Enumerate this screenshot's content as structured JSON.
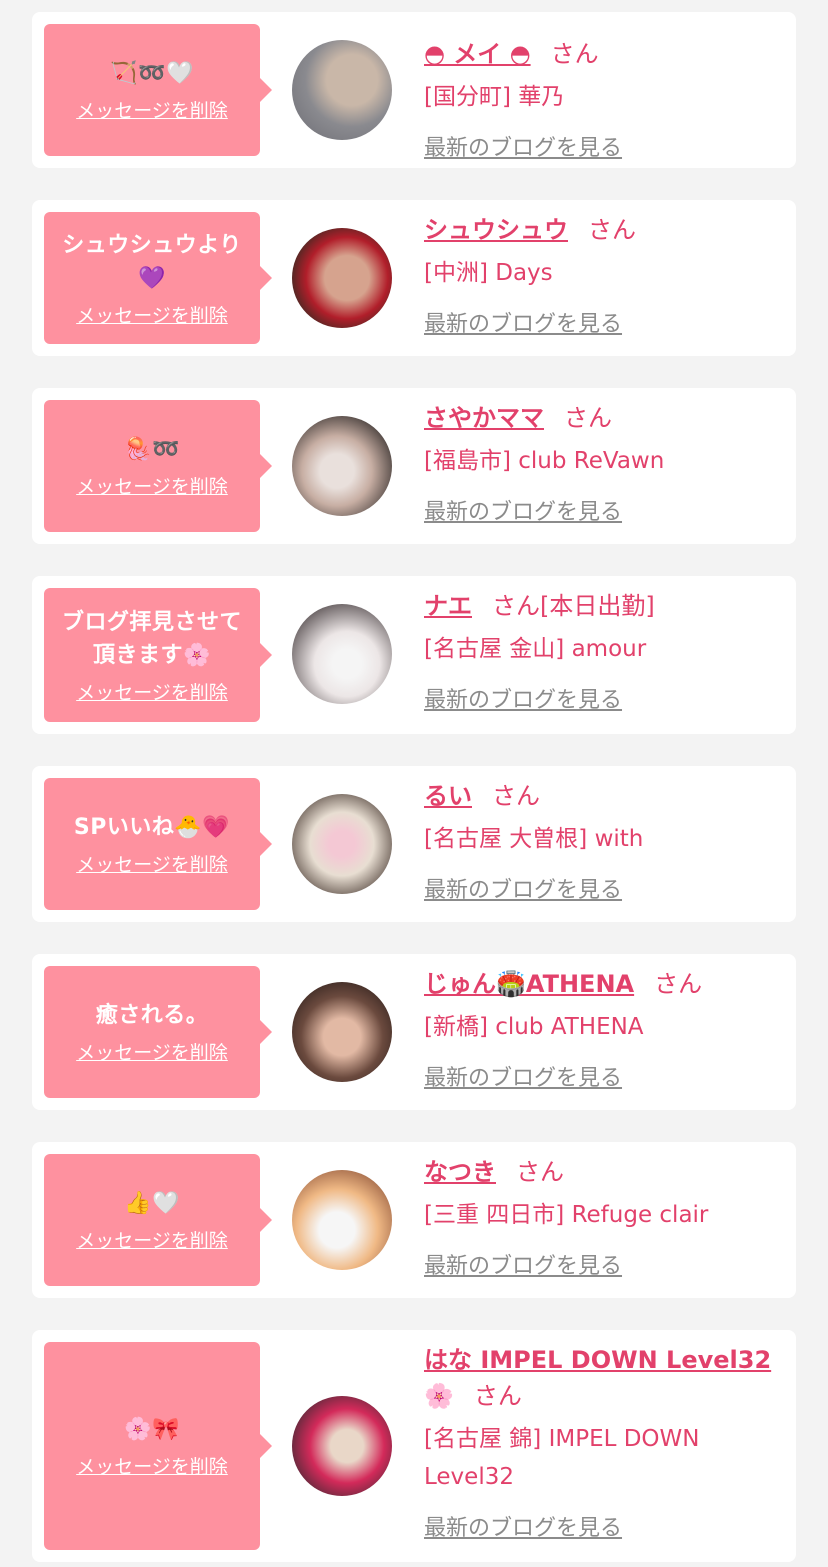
{
  "cards": [
    {
      "message": "🏹➿🤍",
      "delete_label": "メッセージを削除",
      "name": "◓ メイ ◓",
      "honorific": "さん",
      "status": "",
      "shop": "[国分町] 華乃",
      "blog_label": "最新のブログを見る",
      "avatar_colors": [
        "#6b6b72",
        "#c9b7a8",
        "#8a8a8f"
      ]
    },
    {
      "message": "シュウシュウより💜",
      "delete_label": "メッセージを削除",
      "name": "シュウシュウ",
      "honorific": "さん",
      "status": "",
      "shop": "[中洲] Days",
      "blog_label": "最新のブログを見る",
      "avatar_colors": [
        "#3a2a22",
        "#d6a38e",
        "#b11e2a"
      ]
    },
    {
      "message": "🪼➿",
      "delete_label": "メッセージを削除",
      "name": "さやかママ",
      "honorific": "さん",
      "status": "",
      "shop": "[福島市] club ReVawn",
      "blog_label": "最新のブログを見る",
      "avatar_colors": [
        "#2b2625",
        "#c7aea3",
        "#e9e0dc"
      ]
    },
    {
      "message": "ブログ拝見させて頂きます🌸",
      "delete_label": "メッセージを削除",
      "name": "ナエ",
      "honorific": "さん",
      "status": "[本日出勤]",
      "shop": "[名古屋 金山] amour",
      "blog_label": "最新のブログを見る",
      "avatar_colors": [
        "#ece6e6",
        "#3a3133",
        "#f5f5f5"
      ]
    },
    {
      "message": "SPいいね🐣💗",
      "delete_label": "メッセージを削除",
      "name": "るい",
      "honorific": "さん",
      "status": "",
      "shop": "[名古屋 大曽根] with",
      "blog_label": "最新のブログを見る",
      "avatar_colors": [
        "#e8ded2",
        "#3b2c25",
        "#f4c8d4"
      ]
    },
    {
      "message": "癒される。",
      "delete_label": "メッセージを削除",
      "name": "じゅん🏟️ATHENA",
      "honorific": "さん",
      "status": "",
      "shop": "[新橋] club ATHENA",
      "blog_label": "最新のブログを見る",
      "avatar_colors": [
        "#2a1d1a",
        "#e2b9a4",
        "#6b4a3e"
      ]
    },
    {
      "message": "👍🤍",
      "delete_label": "メッセージを削除",
      "name": "なつき",
      "honorific": "さん",
      "status": "",
      "shop": "[三重 四日市] Refuge clair",
      "blog_label": "最新のブログを見る",
      "avatar_colors": [
        "#f0b985",
        "#7a3f2a",
        "#f6f6f6"
      ]
    },
    {
      "message": "🌸🎀",
      "delete_label": "メッセージを削除",
      "name": "はな IMPEL DOWN Level32",
      "name_suffix": "🌸",
      "honorific": "さん",
      "status": "",
      "shop": "[名古屋 錦] IMPEL DOWN Level32",
      "blog_label": "最新のブログを見る",
      "avatar_colors": [
        "#2a2a2e",
        "#d32a5a",
        "#e9d7c8"
      ]
    }
  ]
}
